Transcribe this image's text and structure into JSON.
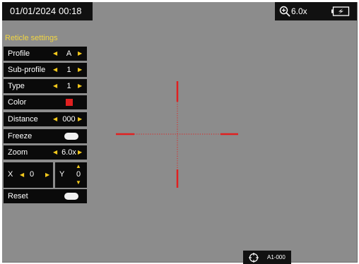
{
  "status": {
    "date": "01/01/2024",
    "time": "00:18",
    "zoom": "6.0x",
    "icons": {
      "zoom": "zoom-in-icon",
      "battery": "battery-icon",
      "target": "target-icon"
    }
  },
  "reticle_settings": {
    "title": "Reticle settings",
    "rows": [
      {
        "label": "Profile",
        "value": "A"
      },
      {
        "label": "Sub-profile",
        "value": "1"
      },
      {
        "label": "Type",
        "value": "1"
      },
      {
        "label": "Color",
        "value_color": "#e02020"
      },
      {
        "label": "Distance",
        "value": "000"
      },
      {
        "label": "Freeze",
        "toggle": "off"
      },
      {
        "label": "Zoom",
        "value": "6.0x"
      },
      {
        "label": "Reset",
        "toggle": "off"
      }
    ],
    "x": {
      "label": "X",
      "value": "0"
    },
    "y": {
      "label": "Y",
      "value": "0"
    }
  },
  "footer": {
    "profile_code": "A1-000"
  },
  "colors": {
    "background": "#8c8c8c",
    "panel": "#0a0a0a",
    "accent": "#f2c81c",
    "title": "#f2d641",
    "reticle": "#e02020"
  }
}
